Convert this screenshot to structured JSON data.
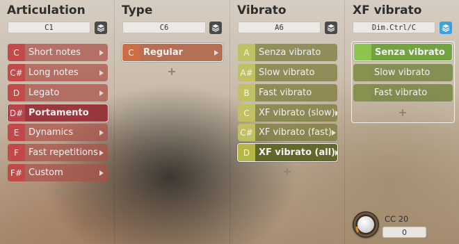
{
  "columns": {
    "articulation": {
      "title": "Articulation",
      "key_value": "C1",
      "items": [
        {
          "key": "C",
          "label": "Short notes",
          "selected": false
        },
        {
          "key": "C#",
          "label": "Long notes",
          "selected": false
        },
        {
          "key": "D",
          "label": "Legato",
          "selected": false
        },
        {
          "key": "D#",
          "label": "Portamento",
          "selected": true
        },
        {
          "key": "E",
          "label": "Dynamics",
          "selected": false
        },
        {
          "key": "F",
          "label": "Fast repetitions",
          "selected": false
        },
        {
          "key": "F#",
          "label": "Custom",
          "selected": false
        }
      ]
    },
    "type": {
      "title": "Type",
      "key_value": "C6",
      "items": [
        {
          "key": "C",
          "label": "Regular",
          "selected": true
        }
      ]
    },
    "vibrato": {
      "title": "Vibrato",
      "key_value": "A6",
      "items": [
        {
          "key": "A",
          "label": "Senza vibrato",
          "selected": false,
          "submenu": false
        },
        {
          "key": "A#",
          "label": "Slow vibrato",
          "selected": false,
          "submenu": false
        },
        {
          "key": "B",
          "label": "Fast vibrato",
          "selected": false,
          "submenu": false
        },
        {
          "key": "C",
          "label": "XF vibrato (slow)",
          "selected": false,
          "submenu": true
        },
        {
          "key": "C#",
          "label": "XF vibrato (fast)",
          "selected": false,
          "submenu": true
        },
        {
          "key": "D",
          "label": "XF vibrato (all)",
          "selected": true,
          "submenu": true
        }
      ]
    },
    "xf_vibrato": {
      "title": "XF vibrato",
      "key_value": "Dim.Ctrl/C",
      "items": [
        {
          "label": "Senza vibrato",
          "selected": true
        },
        {
          "label": "Slow vibrato",
          "selected": false
        },
        {
          "label": "Fast vibrato",
          "selected": false
        }
      ],
      "controller": {
        "label": "CC 20",
        "value": "0"
      }
    }
  },
  "colors": {
    "articulation_key": "#c44646",
    "type_key": "#cd6e46",
    "vibrato_key": "#c4c466",
    "xf_selected": "#8cc44e",
    "active_toggle": "#3aa2df"
  },
  "icons": {
    "add": "plus-icon",
    "layers": "layers-icon",
    "submenu": "chevron-right-icon"
  }
}
